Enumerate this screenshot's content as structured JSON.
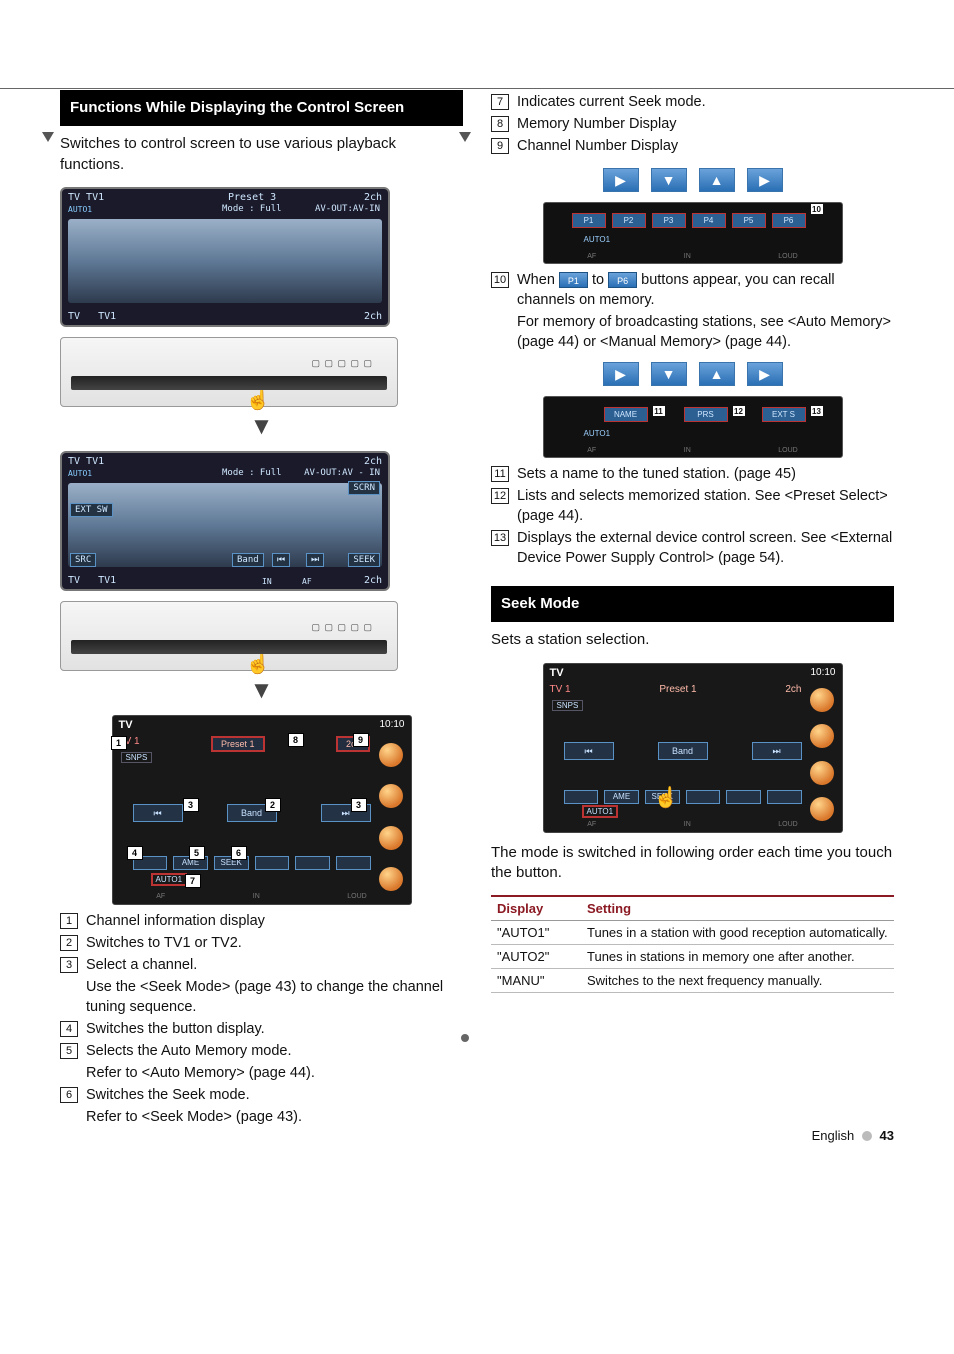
{
  "left": {
    "header": "Functions While Displaying the Control Screen",
    "intro": "Switches to control screen to use various playback functions.",
    "shot1": {
      "top_left": "TV TV1",
      "sub": "AUTO1",
      "preset": "Preset 3",
      "mode": "Mode : Full",
      "top_right_ch": "2ch",
      "avout": "AV-OUT:AV-IN",
      "bot_left": "TV",
      "bot_left2": "TV1",
      "bot_right": "2ch"
    },
    "shot2": {
      "top_left": "TV TV1",
      "sub": "AUTO1",
      "mode": "Mode : Full",
      "top_right_ch": "2ch",
      "avout": "AV-OUT:AV - IN",
      "extsw": "EXT SW",
      "scrn": "SCRN",
      "src": "SRC",
      "band": "Band",
      "seek": "SEEK",
      "bot_left": "TV",
      "bot_left2": "TV1",
      "bot_right": "2ch",
      "in": "IN",
      "af": "AF"
    },
    "shot3": {
      "hdr": "TV",
      "time": "10:10",
      "tv1": "TV 1",
      "preset": "Preset 1",
      "ch": "2ch",
      "snps": "SNPS",
      "band": "Band",
      "ame": "AME",
      "seek": "SEEK",
      "auto": "AUTO1",
      "foot": {
        "af": "AF",
        "in": "IN",
        "loud": "LOUD"
      },
      "callouts": {
        "c1": "1",
        "c2": "2",
        "c3a": "3",
        "c3b": "3",
        "c4": "4",
        "c5": "5",
        "c6": "6",
        "c7": "7",
        "c8": "8",
        "c9": "9"
      }
    },
    "items": [
      {
        "n": "1",
        "t": "Channel information display"
      },
      {
        "n": "2",
        "t": "Switches to TV1 or TV2."
      },
      {
        "n": "3",
        "t": "Select a channel."
      },
      {
        "cont": "Use the <Seek Mode> (page 43) to change the channel tuning sequence."
      },
      {
        "n": "4",
        "t": "Switches the button display."
      },
      {
        "n": "5",
        "t": "Selects the Auto Memory mode."
      },
      {
        "cont": "Refer to <Auto Memory> (page 44)."
      },
      {
        "n": "6",
        "t": "Switches the Seek mode."
      },
      {
        "cont": "Refer to <Seek Mode> (page 43)."
      }
    ]
  },
  "right": {
    "items_a": [
      {
        "n": "7",
        "t": "Indicates current Seek mode."
      },
      {
        "n": "8",
        "t": "Memory Number Display"
      },
      {
        "n": "9",
        "t": "Channel Number Display"
      }
    ],
    "frag1": {
      "p": [
        "P1",
        "P2",
        "P3",
        "P4",
        "P5",
        "P6"
      ],
      "auto": "AUTO1",
      "af": "AF",
      "in": "IN",
      "loud": "LOUD",
      "callout": "10"
    },
    "item10_pre": "When ",
    "item10_pill1": "P1",
    "item10_mid": " to ",
    "item10_pill2": "P6",
    "item10_post": " buttons appear, you can recall channels on memory.",
    "item10_cont": "For memory of broadcasting stations, see <Auto Memory> (page 44) or <Manual Memory> (page 44).",
    "frag2": {
      "name": "NAME",
      "prs": "PRS",
      "ext": "EXT S",
      "auto": "AUTO1",
      "af": "AF",
      "in": "IN",
      "loud": "LOUD",
      "c11": "11",
      "c12": "12",
      "c13": "13"
    },
    "items_b": [
      {
        "n": "11",
        "t": "Sets a name to the tuned station. (page 45)"
      },
      {
        "n": "12",
        "t": "Lists and selects memorized station. See <Preset Select> (page 44)."
      },
      {
        "n": "13",
        "t": "Displays the external device control screen. See <External Device Power Supply Control> (page 54)."
      }
    ],
    "seek": {
      "header": "Seek Mode",
      "intro": "Sets a station selection.",
      "shot": {
        "hdr": "TV",
        "time": "10:10",
        "tv1": "TV 1",
        "preset": "Preset 1",
        "ch": "2ch",
        "snps": "SNPS",
        "band": "Band",
        "ame": "AME",
        "seek": "SEEK",
        "auto": "AUTO1",
        "af": "AF",
        "in": "IN",
        "loud": "LOUD"
      },
      "table_note": "The mode is switched in following order each time you touch the button.",
      "th1": "Display",
      "th2": "Setting",
      "rows": [
        {
          "d": "\"AUTO1\"",
          "s": "Tunes in a station with good reception automatically."
        },
        {
          "d": "\"AUTO2\"",
          "s": "Tunes in stations in memory one after another."
        },
        {
          "d": "\"MANU\"",
          "s": "Switches to the next frequency manually."
        }
      ]
    }
  },
  "footer": {
    "lang": "English",
    "page": "43"
  }
}
